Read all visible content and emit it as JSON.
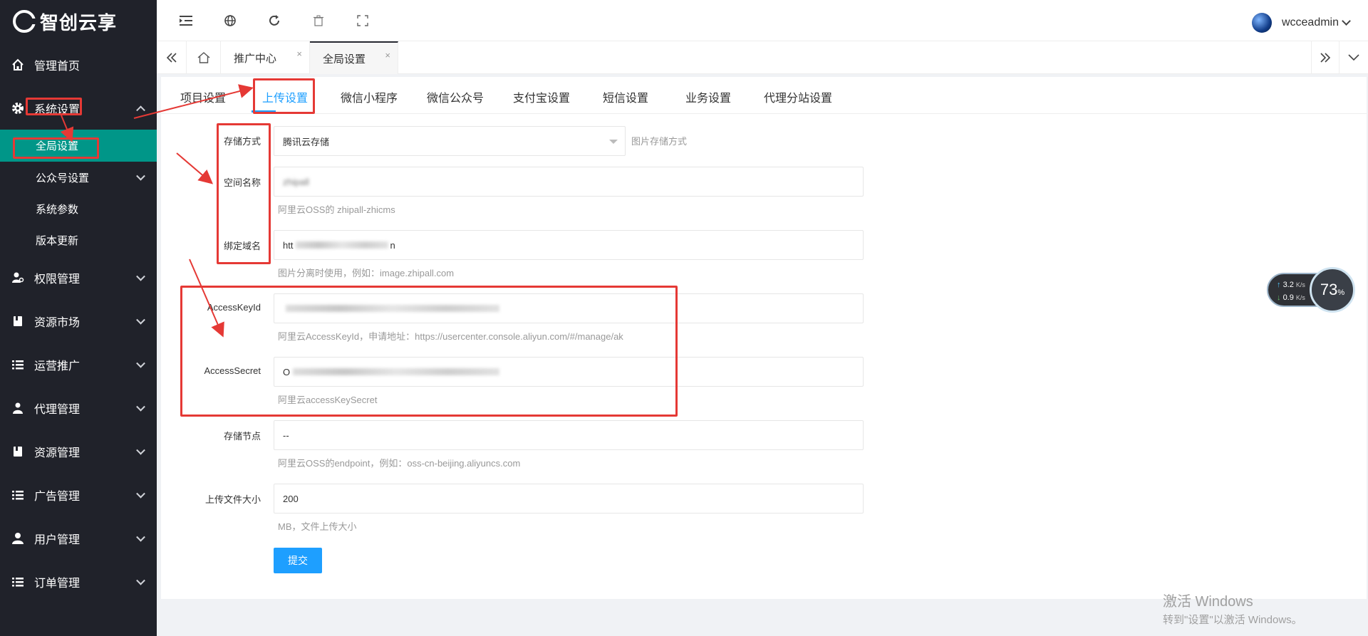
{
  "logo": {
    "text": "智创云享"
  },
  "sidebar": {
    "items": [
      {
        "label": "管理首页"
      },
      {
        "label": "系统设置"
      },
      {
        "label": "全局设置"
      },
      {
        "label": "公众号设置"
      },
      {
        "label": "系统参数"
      },
      {
        "label": "版本更新"
      },
      {
        "label": "权限管理"
      },
      {
        "label": "资源市场"
      },
      {
        "label": "运营推广"
      },
      {
        "label": "代理管理"
      },
      {
        "label": "资源管理"
      },
      {
        "label": "广告管理"
      },
      {
        "label": "用户管理"
      },
      {
        "label": "订单管理"
      }
    ]
  },
  "header": {
    "username": "wcceadmin"
  },
  "tabs": [
    {
      "label": "推广中心",
      "close": "×"
    },
    {
      "label": "全局设置",
      "close": "×"
    }
  ],
  "settings_tabs": [
    "项目设置",
    "上传设置",
    "微信小程序",
    "微信公众号",
    "支付宝设置",
    "短信设置",
    "业务设置",
    "代理分站设置"
  ],
  "form": {
    "storage_label": "存储方式",
    "storage_value": "腾讯云存储",
    "storage_hint": "图片存储方式",
    "bucket_label": "空间名称",
    "bucket_value": "zhipall",
    "bucket_hint": "阿里云OSS的 zhipall-zhicms",
    "domain_label": "绑定域名",
    "domain_value_start": "htt",
    "domain_value_end": "n",
    "domain_hint": "图片分离时使用，例如：image.zhipall.com",
    "keyid_label": "AccessKeyId",
    "keyid_hint": "阿里云AccessKeyId，申请地址：https://usercenter.console.aliyun.com/#/manage/ak",
    "secret_label": "AccessSecret",
    "secret_value_start": "O",
    "secret_hint": "阿里云accessKeySecret",
    "endpoint_label": "存储节点",
    "endpoint_value": "--",
    "endpoint_hint": "阿里云OSS的endpoint，例如：oss-cn-beijing.aliyuncs.com",
    "size_label": "上传文件大小",
    "size_value": "200",
    "size_hint": "MB，文件上传大小",
    "submit": "提交"
  },
  "speed": {
    "up": "3.2",
    "down": "0.9",
    "unit": "K/s",
    "percent": "73",
    "percent_sign": "%"
  },
  "watermark": {
    "line1": "激活 Windows",
    "line2": "转到\"设置\"以激活 Windows。"
  }
}
